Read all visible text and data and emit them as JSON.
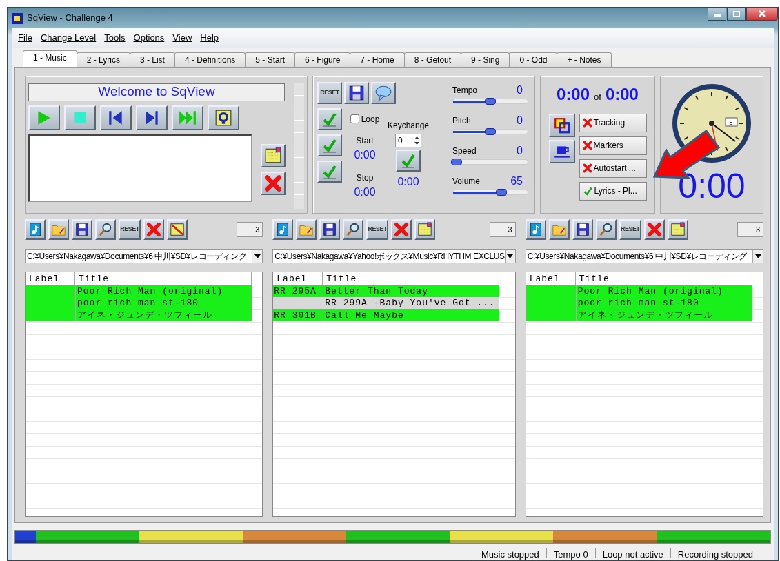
{
  "window": {
    "title": "SqView - Challenge 4"
  },
  "menu": [
    {
      "label": "File"
    },
    {
      "label": "Change Level"
    },
    {
      "label": "Tools"
    },
    {
      "label": "Options"
    },
    {
      "label": "View"
    },
    {
      "label": "Help"
    }
  ],
  "tabs": [
    {
      "label": "1 - Music",
      "selected": true
    },
    {
      "label": "2 - Lyrics",
      "selected": false
    },
    {
      "label": "3 - List",
      "selected": false
    },
    {
      "label": "4 - Definitions",
      "selected": false
    },
    {
      "label": "5 - Start",
      "selected": false
    },
    {
      "label": "6 - Figure",
      "selected": false
    },
    {
      "label": "7 - Home",
      "selected": false
    },
    {
      "label": "8 - Getout",
      "selected": false
    },
    {
      "label": "9 - Sing",
      "selected": false
    },
    {
      "label": "0 - Odd",
      "selected": false
    },
    {
      "label": "+ - Notes",
      "selected": false
    }
  ],
  "player": {
    "title": "Welcome to SqView"
  },
  "controls": {
    "reset_button": "RESET",
    "loop": {
      "label": "Loop",
      "checked": false
    },
    "start": {
      "label": "Start",
      "time": "0:00"
    },
    "stop": {
      "label": "Stop",
      "time": "0:00"
    },
    "keychange": {
      "label": "Keychange",
      "value": "0",
      "time": "0:00"
    },
    "sliders": [
      {
        "name": "Tempo",
        "reading": "0",
        "level": 0.5
      },
      {
        "name": "Pitch",
        "reading": "0",
        "level": 0.5
      },
      {
        "name": "Speed",
        "reading": "0",
        "level": 0.05
      },
      {
        "name": "Volume",
        "reading": "65",
        "level": 0.65
      }
    ]
  },
  "position": {
    "elapsed": "0:00",
    "of": "of",
    "total": "0:00",
    "toggles": [
      {
        "label": "Tracking",
        "enabled": false
      },
      {
        "label": "Markers",
        "enabled": false
      },
      {
        "label": "Autostart ...",
        "enabled": false
      },
      {
        "label": "Lyrics - Pl...",
        "enabled": true
      }
    ]
  },
  "clock": {
    "date": "8",
    "time": "0:00"
  },
  "playlists": [
    {
      "reset_button": "RESET",
      "count": "3",
      "path": "C:¥Users¥Nakagawa¥Documents¥6 中川¥SD¥レコーディング",
      "columns": [
        "Label",
        "Title"
      ],
      "rows": [
        {
          "label": "",
          "title": "Poor Rich Man (original)",
          "selected": true
        },
        {
          "label": "",
          "title": "poor rich man  st-180",
          "selected": true
        },
        {
          "label": "",
          "title": "アイネ・ジュンデ・ツフィール",
          "selected": true
        }
      ]
    },
    {
      "reset_button": "RESET",
      "count": "3",
      "path": "C:¥Users¥Nakagawa¥Yahoo!ボックス¥Music¥RHYTHM EXCLUS",
      "columns": [
        "Label",
        "Title"
      ],
      "rows": [
        {
          "label": "RR 295A",
          "title": "Better Than  Today",
          "selected": true
        },
        {
          "label": "",
          "title": "RR 299A -Baby You've Got ...",
          "selected": false
        },
        {
          "label": "RR 301B",
          "title": "Call Me Maybe",
          "selected": true
        }
      ]
    },
    {
      "reset_button": "RESET",
      "count": "3",
      "path": "C:¥Users¥Nakagawa¥Documents¥6 中川¥SD¥レコーディング",
      "columns": [
        "Label",
        "Title"
      ],
      "rows": [
        {
          "label": "",
          "title": "Poor Rich Man (original)",
          "selected": true
        },
        {
          "label": "",
          "title": "poor rich man  st-180",
          "selected": true
        },
        {
          "label": "",
          "title": "アイネ・ジュンデ・ツフィール",
          "selected": true
        }
      ]
    }
  ],
  "timeline": [
    {
      "color": "#2040d0"
    },
    {
      "color": "#20c020"
    },
    {
      "color": "#e8e048"
    },
    {
      "color": "#d8883a"
    },
    {
      "color": "#20c020"
    },
    {
      "color": "#e8e048"
    },
    {
      "color": "#d8883a"
    },
    {
      "color": "#20c020"
    }
  ],
  "status_bar": [
    "Music stopped",
    "Tempo 0",
    "Loop not active",
    "Recording stopped"
  ]
}
